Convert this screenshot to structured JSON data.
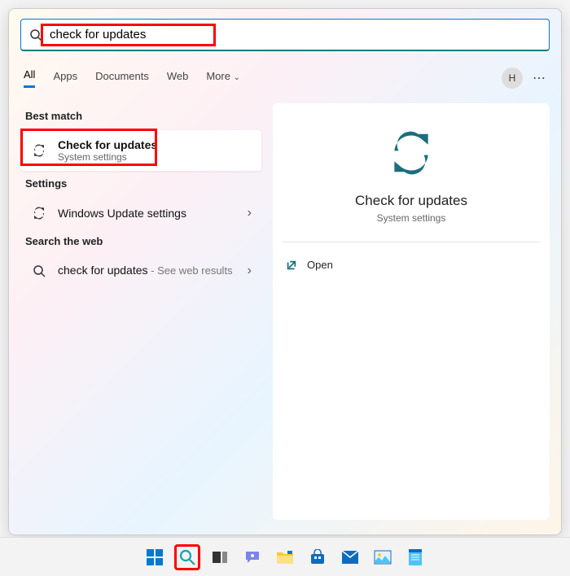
{
  "search": {
    "value": "check for updates"
  },
  "tabs": {
    "all": "All",
    "apps": "Apps",
    "documents": "Documents",
    "web": "Web",
    "more": "More"
  },
  "avatar": "H",
  "sections": {
    "best": "Best match",
    "settings": "Settings",
    "web": "Search the web"
  },
  "bestMatch": {
    "title": "Check for updates",
    "subtitle": "System settings"
  },
  "settingsResult": {
    "title": "Windows Update settings"
  },
  "webResult": {
    "main": "check for updates",
    "sub": " - See web results"
  },
  "preview": {
    "title": "Check for updates",
    "subtitle": "System settings",
    "open": "Open"
  }
}
